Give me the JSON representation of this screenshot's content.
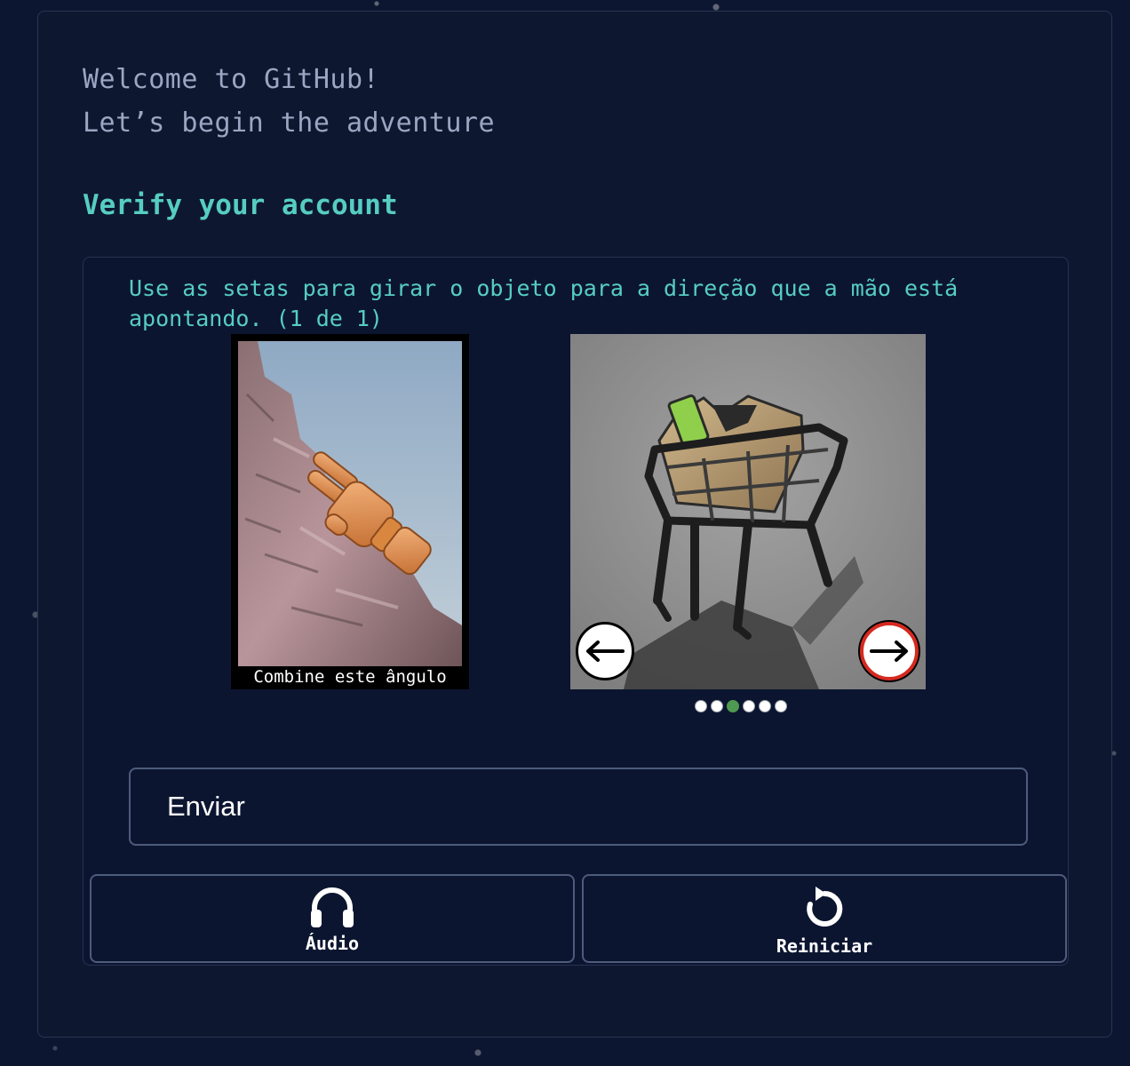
{
  "welcome": {
    "line1": "Welcome to GitHub!",
    "line2": "Let’s begin the adventure"
  },
  "verify": {
    "title": "Verify your account"
  },
  "challenge": {
    "instruction": "Use as setas para girar o objeto para a direção que a mão está apontando. (1 de 1)",
    "reference_caption": "Combine este ângulo",
    "reference_image": "wooden-hand-pointing-image",
    "object_image": "shopping-cart-with-box-image",
    "rotation": {
      "total_steps": 6,
      "current_step": 3
    },
    "left_arrow_icon": "arrow-left-icon",
    "right_arrow_icon": "arrow-right-icon"
  },
  "actions": {
    "submit_label": "Enviar",
    "audio_label": "Áudio",
    "audio_icon": "headphones-icon",
    "restart_label": "Reiniciar",
    "restart_icon": "restart-icon"
  },
  "colors": {
    "background": "#0d1630",
    "accent": "#56cdc3",
    "muted_text": "#9aa6c2",
    "active_dot": "#4f9a52",
    "right_arrow_ring": "#d42a20"
  }
}
